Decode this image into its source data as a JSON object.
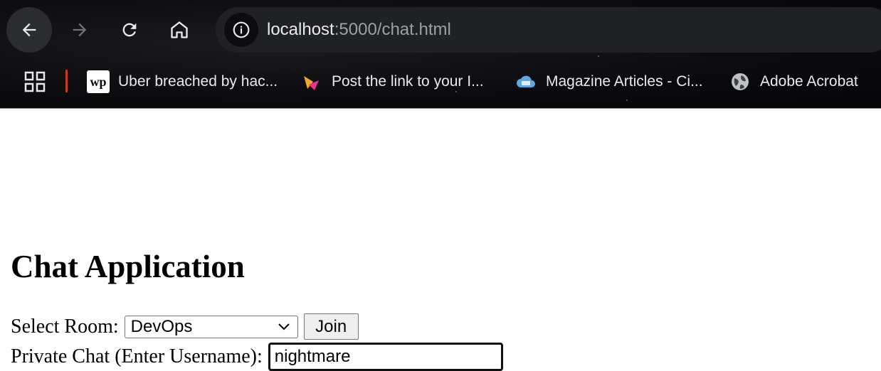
{
  "browser": {
    "url_host": "localhost",
    "url_rest": ":5000/chat.html",
    "icons": {
      "back": "arrow-left-icon",
      "forward": "arrow-right-icon",
      "reload": "reload-icon",
      "home": "home-icon",
      "site_info": "info-icon",
      "apps": "apps-grid-icon"
    },
    "bookmarks": [
      {
        "label": "Uber breached by hac...",
        "icon": "washington-post-icon"
      },
      {
        "label": "Post the link to your I...",
        "icon": "pendo-icon"
      },
      {
        "label": "Magazine Articles - Ci...",
        "icon": "cloud-icon"
      },
      {
        "label": "Adobe Acrobat",
        "icon": "globe-icon"
      }
    ]
  },
  "page": {
    "title": "Chat Application",
    "room_label": "Select Room:",
    "room_selected": "DevOps",
    "join_label": "Join",
    "private_label": "Private Chat (Enter Username):",
    "username_value": "nightmare"
  },
  "colors": {
    "chrome_bg": "#0b0b0e",
    "address_bg": "#202124",
    "accent_red": "#c83c1c"
  }
}
